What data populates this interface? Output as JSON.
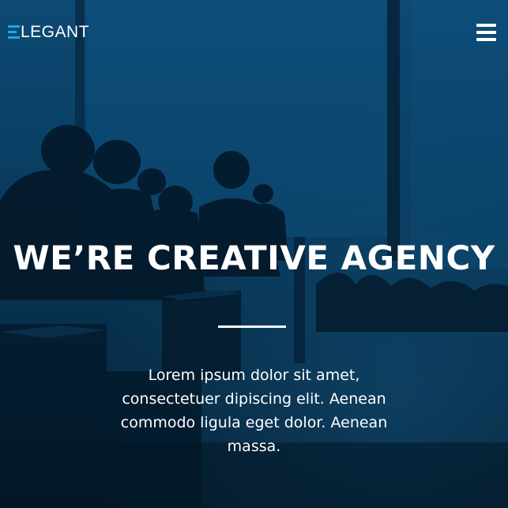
{
  "brand": {
    "logo_text": "LEGANT",
    "accent_color": "#1fa6e6"
  },
  "nav": {
    "menu_icon": "hamburger-menu-icon"
  },
  "hero": {
    "title": "WE’RE CREATIVE AGENCY",
    "description": "Lorem ipsum dolor sit amet, consectetuer dipiscing elit. Aenean commodo ligula eget dolor. Aenean massa.",
    "overlay_color": "#0a3e63"
  }
}
